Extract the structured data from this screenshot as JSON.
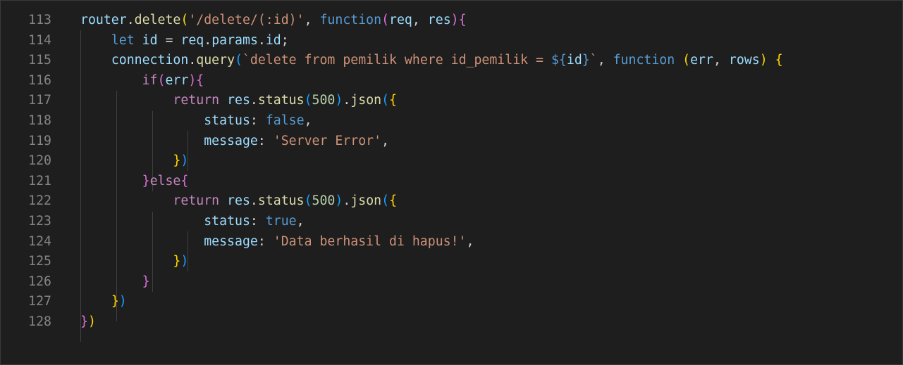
{
  "editor": {
    "lines": [
      {
        "number": "113",
        "tokens": [
          {
            "text": "router",
            "c": "var"
          },
          {
            "text": ".",
            "c": "op"
          },
          {
            "text": "delete",
            "c": "fn"
          },
          {
            "text": "(",
            "c": "b1"
          },
          {
            "text": "'/delete/(:id)'",
            "c": "str"
          },
          {
            "text": ", ",
            "c": "op"
          },
          {
            "text": "function",
            "c": "kw"
          },
          {
            "text": "(",
            "c": "b2"
          },
          {
            "text": "req",
            "c": "var"
          },
          {
            "text": ", ",
            "c": "op"
          },
          {
            "text": "res",
            "c": "var"
          },
          {
            "text": ")",
            "c": "b2"
          },
          {
            "text": "{",
            "c": "b2"
          }
        ]
      },
      {
        "number": "114",
        "tokens": [
          {
            "text": "    "
          },
          {
            "text": "let",
            "c": "kw"
          },
          {
            "text": " "
          },
          {
            "text": "id",
            "c": "var"
          },
          {
            "text": " = ",
            "c": "op"
          },
          {
            "text": "req",
            "c": "var"
          },
          {
            "text": ".",
            "c": "op"
          },
          {
            "text": "params",
            "c": "var"
          },
          {
            "text": ".",
            "c": "op"
          },
          {
            "text": "id",
            "c": "var"
          },
          {
            "text": ";",
            "c": "op"
          }
        ]
      },
      {
        "number": "115",
        "tokens": [
          {
            "text": "    "
          },
          {
            "text": "connection",
            "c": "var"
          },
          {
            "text": ".",
            "c": "op"
          },
          {
            "text": "query",
            "c": "fn"
          },
          {
            "text": "(",
            "c": "b3"
          },
          {
            "text": "`delete from pemilik where id_pemilik = ",
            "c": "str"
          },
          {
            "text": "${",
            "c": "tpl"
          },
          {
            "text": "id",
            "c": "var"
          },
          {
            "text": "}",
            "c": "tpl"
          },
          {
            "text": "`",
            "c": "str"
          },
          {
            "text": ", ",
            "c": "op"
          },
          {
            "text": "function",
            "c": "kw"
          },
          {
            "text": " "
          },
          {
            "text": "(",
            "c": "b1"
          },
          {
            "text": "err",
            "c": "var"
          },
          {
            "text": ", ",
            "c": "op"
          },
          {
            "text": "rows",
            "c": "var"
          },
          {
            "text": ")",
            "c": "b1"
          },
          {
            "text": " "
          },
          {
            "text": "{",
            "c": "b1"
          }
        ]
      },
      {
        "number": "116",
        "tokens": [
          {
            "text": "        "
          },
          {
            "text": "if",
            "c": "ctl"
          },
          {
            "text": "(",
            "c": "b2"
          },
          {
            "text": "err",
            "c": "var"
          },
          {
            "text": ")",
            "c": "b2"
          },
          {
            "text": "{",
            "c": "b2"
          }
        ]
      },
      {
        "number": "117",
        "tokens": [
          {
            "text": "            "
          },
          {
            "text": "return",
            "c": "ctl"
          },
          {
            "text": " "
          },
          {
            "text": "res",
            "c": "var"
          },
          {
            "text": ".",
            "c": "op"
          },
          {
            "text": "status",
            "c": "fn"
          },
          {
            "text": "(",
            "c": "b3"
          },
          {
            "text": "500",
            "c": "num"
          },
          {
            "text": ")",
            "c": "b3"
          },
          {
            "text": ".",
            "c": "op"
          },
          {
            "text": "json",
            "c": "fn"
          },
          {
            "text": "(",
            "c": "b3"
          },
          {
            "text": "{",
            "c": "b1"
          }
        ]
      },
      {
        "number": "118",
        "tokens": [
          {
            "text": "                "
          },
          {
            "text": "status",
            "c": "var"
          },
          {
            "text": ": ",
            "c": "op"
          },
          {
            "text": "false",
            "c": "kw"
          },
          {
            "text": ",",
            "c": "op"
          }
        ]
      },
      {
        "number": "119",
        "tokens": [
          {
            "text": "                "
          },
          {
            "text": "message",
            "c": "var"
          },
          {
            "text": ": ",
            "c": "op"
          },
          {
            "text": "'Server Error'",
            "c": "str"
          },
          {
            "text": ",",
            "c": "op"
          }
        ]
      },
      {
        "number": "120",
        "tokens": [
          {
            "text": "            "
          },
          {
            "text": "}",
            "c": "b1"
          },
          {
            "text": ")",
            "c": "b3"
          }
        ]
      },
      {
        "number": "121",
        "tokens": [
          {
            "text": "        "
          },
          {
            "text": "}",
            "c": "b2"
          },
          {
            "text": "else",
            "c": "ctl"
          },
          {
            "text": "{",
            "c": "b2"
          }
        ]
      },
      {
        "number": "122",
        "tokens": [
          {
            "text": "            "
          },
          {
            "text": "return",
            "c": "ctl"
          },
          {
            "text": " "
          },
          {
            "text": "res",
            "c": "var"
          },
          {
            "text": ".",
            "c": "op"
          },
          {
            "text": "status",
            "c": "fn"
          },
          {
            "text": "(",
            "c": "b3"
          },
          {
            "text": "500",
            "c": "num"
          },
          {
            "text": ")",
            "c": "b3"
          },
          {
            "text": ".",
            "c": "op"
          },
          {
            "text": "json",
            "c": "fn"
          },
          {
            "text": "(",
            "c": "b3"
          },
          {
            "text": "{",
            "c": "b1"
          }
        ]
      },
      {
        "number": "123",
        "tokens": [
          {
            "text": "                "
          },
          {
            "text": "status",
            "c": "var"
          },
          {
            "text": ": ",
            "c": "op"
          },
          {
            "text": "true",
            "c": "kw"
          },
          {
            "text": ",",
            "c": "op"
          }
        ]
      },
      {
        "number": "124",
        "tokens": [
          {
            "text": "                "
          },
          {
            "text": "message",
            "c": "var"
          },
          {
            "text": ": ",
            "c": "op"
          },
          {
            "text": "'Data berhasil di hapus!'",
            "c": "str"
          },
          {
            "text": ",",
            "c": "op"
          }
        ]
      },
      {
        "number": "125",
        "tokens": [
          {
            "text": "            "
          },
          {
            "text": "}",
            "c": "b1"
          },
          {
            "text": ")",
            "c": "b3"
          }
        ]
      },
      {
        "number": "126",
        "tokens": [
          {
            "text": "        "
          },
          {
            "text": "}",
            "c": "b2"
          }
        ]
      },
      {
        "number": "127",
        "tokens": [
          {
            "text": "    "
          },
          {
            "text": "}",
            "c": "b1"
          },
          {
            "text": ")",
            "c": "b3"
          }
        ]
      },
      {
        "number": "128",
        "tokens": [
          {
            "text": "}",
            "c": "b2"
          },
          {
            "text": ")",
            "c": "b1"
          }
        ]
      }
    ]
  }
}
